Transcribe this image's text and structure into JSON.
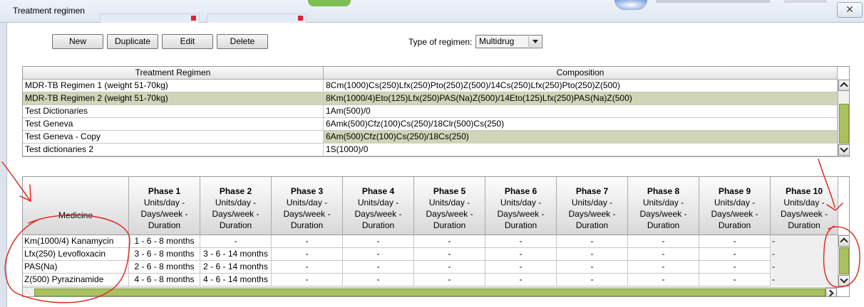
{
  "window": {
    "title": "Treatment regimen",
    "close_icon": "close-icon"
  },
  "toolbar": {
    "buttons": [
      "New",
      "Duplicate",
      "Edit",
      "Delete"
    ],
    "type_label": "Type of regimen:",
    "type_value": "Multidrug"
  },
  "regimens": {
    "headers": [
      "Treatment Regimen",
      "Composition"
    ],
    "selected_index": 1,
    "rows": [
      {
        "name": "MDR-TB Regimen 1 (weight 51-70kg)",
        "composition": "8Cm(1000)Cs(250)Lfx(250)Pto(250)Z(500)/14Cs(250)Lfx(250)Pto(250)Z(500)"
      },
      {
        "name": "MDR-TB Regimen 2 (weight 51-70kg)",
        "composition": "8Km(1000/4)Eto(125)Lfx(250)PAS(Na)Z(500)/14Eto(125)Lfx(250)PAS(Na)Z(500)"
      },
      {
        "name": "Test Dictionaries",
        "composition": "1Am(500)/0"
      },
      {
        "name": "Test Geneva",
        "composition": "6Amk(500)Cfz(100)Cs(250)/18Clr(500)Cs(250)"
      },
      {
        "name": "Test Geneva - Copy",
        "composition": "6Am(500)Cfz(100)Cs(250)/18Cs(250)"
      },
      {
        "name": "Test dictionaries 2",
        "composition": "1S(1000)/0"
      }
    ]
  },
  "medicines": {
    "medicine_header": "Medicine",
    "phase_sub": [
      "Units/day -",
      "Days/week -",
      "Duration"
    ],
    "phases": [
      "Phase 1",
      "Phase 2",
      "Phase 3",
      "Phase 4",
      "Phase 5",
      "Phase 6",
      "Phase 7",
      "Phase 8",
      "Phase 9",
      "Phase 10"
    ],
    "rows": [
      {
        "name": "Km(1000/4)  Kanamycin",
        "cells": [
          "1 - 6 - 8 months",
          "-",
          "-",
          "-",
          "-",
          "-",
          "-",
          "-",
          "-",
          "-"
        ]
      },
      {
        "name": "Lfx(250)  Levofloxacin",
        "cells": [
          "3 - 6 - 8 months",
          "3 - 6 - 14 months",
          "-",
          "-",
          "-",
          "-",
          "-",
          "-",
          "-",
          "-"
        ]
      },
      {
        "name": "PAS(Na)",
        "cells": [
          "2 - 6 - 8 months",
          "2 - 6 - 14 months",
          "-",
          "-",
          "-",
          "-",
          "-",
          "-",
          "-",
          "-"
        ]
      },
      {
        "name": "Z(500)  Pyrazinamide",
        "cells": [
          "4 - 6 - 8 months",
          "4 - 6 - 14 months",
          "-",
          "-",
          "-",
          "-",
          "-",
          "-",
          "-",
          "-"
        ]
      }
    ]
  },
  "colors": {
    "selection": "#cfd5b6",
    "scroll_thumb": "#a9c25e",
    "annotation": "#e0211b"
  }
}
